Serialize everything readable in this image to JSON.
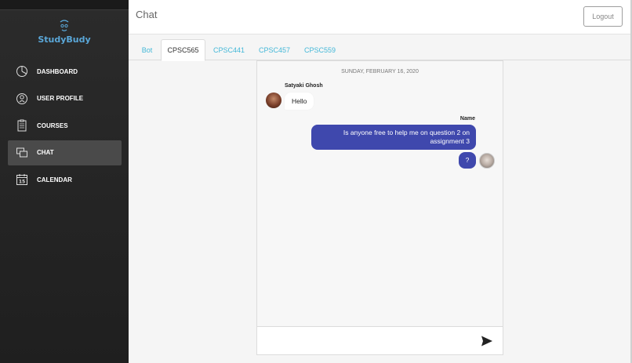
{
  "brand": {
    "name": "StudyBudy",
    "accent": "#5aa7d8"
  },
  "sidebar": {
    "items": [
      {
        "label": "DASHBOARD",
        "icon": "dashboard-icon",
        "active": false
      },
      {
        "label": "USER PROFILE",
        "icon": "user-profile-icon",
        "active": false
      },
      {
        "label": "COURSES",
        "icon": "courses-icon",
        "active": false
      },
      {
        "label": "CHAT",
        "icon": "chat-icon",
        "active": true
      },
      {
        "label": "CALENDAR",
        "icon": "calendar-icon",
        "active": false
      }
    ],
    "calendar_icon_day": "15"
  },
  "header": {
    "title": "Chat",
    "logout_label": "Logout"
  },
  "tabs": [
    {
      "label": "Bot",
      "active": false
    },
    {
      "label": "CPSC565",
      "active": true
    },
    {
      "label": "CPSC441",
      "active": false
    },
    {
      "label": "CPSC457",
      "active": false
    },
    {
      "label": "CPSC559",
      "active": false
    }
  ],
  "chat": {
    "date_separator": "SUNDAY, FEBRUARY 16, 2020",
    "messages": [
      {
        "sender": "Satyaki Ghosh",
        "text": "Hello",
        "direction": "incoming"
      },
      {
        "sender": "Name",
        "text": "Is anyone free to help me on question 2 on assignment 3",
        "direction": "outgoing"
      },
      {
        "sender": "",
        "text": "?",
        "direction": "outgoing"
      }
    ],
    "composer": {
      "value": "",
      "placeholder": ""
    }
  },
  "colors": {
    "outgoing_bubble": "#3f48ad",
    "tab_link": "#44b8d8",
    "sidebar_bg": "#2b2b2b"
  }
}
